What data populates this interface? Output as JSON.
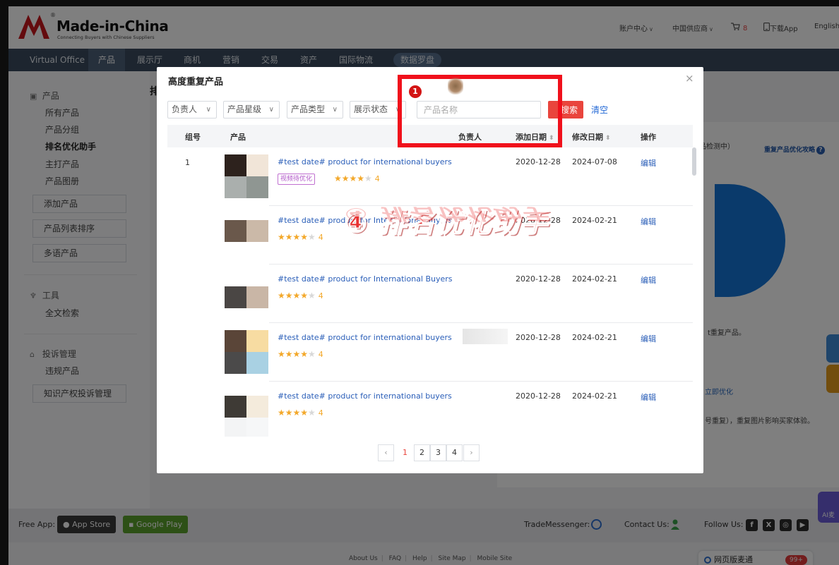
{
  "header": {
    "logo_name": "Made-in-China",
    "logo_slogan": "Connecting Buyers with Chinese Suppliers",
    "logo_reg": "®",
    "account_center": "账户中心",
    "china_supplier": "中国供应商",
    "cart_count": "8",
    "download_app": "下载App",
    "language": "English"
  },
  "nav": {
    "items": [
      "Virtual Office",
      "产品",
      "展示厅",
      "商机",
      "营销",
      "交易",
      "资产",
      "国际物流",
      "数据罗盘"
    ]
  },
  "sidebar": {
    "product_section": "产品",
    "product_items": [
      "所有产品",
      "产品分组",
      "排名优化助手",
      "主打产品",
      "产品图册"
    ],
    "box_buttons": [
      "添加产品",
      "产品列表排序",
      "多语产品"
    ],
    "tools_section": "工具",
    "tools_items": [
      "全文检索"
    ],
    "complaint_section": "投诉管理",
    "complaint_items": [
      "违规产品"
    ],
    "ip_button": "知识产权投诉管理"
  },
  "background": {
    "page_title": "排",
    "note": "品检测中）",
    "guide_link": "重复产品优化攻略",
    "text_repeat": "t重复产品。",
    "text_optimize": "立即优化",
    "text_hint": "号重复），重复图片影响买家体验。"
  },
  "footer": {
    "free_app": "Free App:",
    "app_store": "App Store",
    "google_play": "Google Play",
    "trade_messenger": "TradeMessenger:",
    "contact_us": "Contact Us:",
    "follow_us": "Follow Us:",
    "links": [
      "About Us",
      "FAQ",
      "Help",
      "Site Map",
      "Mobile Site"
    ],
    "webchat": "网页版麦通",
    "webchat_badge": "99+",
    "ai_label": "AI麦"
  },
  "modal": {
    "title": "高度重复产品",
    "close": "×",
    "filters": [
      "负责人",
      "产品星级",
      "产品类型",
      "展示状态"
    ],
    "search_placeholder": "产品名称",
    "search_button": "搜索",
    "clear": "清空",
    "columns": {
      "group": "组号",
      "product": "产品",
      "owner": "负责人",
      "add_date": "添加日期",
      "mod_date": "修改日期",
      "action": "操作"
    },
    "rows": [
      {
        "group": "1",
        "title": "#test date# product for international buyers",
        "tag": "视频待优化",
        "stars": 4,
        "score": "4",
        "add_date": "2020-12-28",
        "mod_date": "2024-07-08",
        "action": "编辑"
      },
      {
        "group": "",
        "title": "#test date# product for International Buyers",
        "tag": "",
        "stars": 4,
        "score": "4",
        "add_date": "2020-12-28",
        "mod_date": "2024-02-21",
        "action": "编辑"
      },
      {
        "group": "",
        "title": "#test date# product for International Buyers",
        "tag": "",
        "stars": 4,
        "score": "4",
        "add_date": "2020-12-28",
        "mod_date": "2024-02-21",
        "action": "编辑"
      },
      {
        "group": "",
        "title": "#test date# product for international buyers",
        "tag": "",
        "stars": 4,
        "score": "4",
        "add_date": "2020-12-28",
        "mod_date": "2024-02-21",
        "action": "编辑"
      },
      {
        "group": "",
        "title": "#test date# product for international buyers",
        "tag": "",
        "stars": 4,
        "score": "4",
        "add_date": "2020-12-28",
        "mod_date": "2024-02-21",
        "action": "编辑"
      }
    ],
    "pagination": {
      "prev": "‹",
      "pages": [
        "1",
        "2",
        "3",
        "4"
      ],
      "current": "1",
      "next": "›"
    }
  },
  "annotation": {
    "marker_number": "1",
    "watermark": "④ 排名优化助手"
  },
  "colors": {
    "nav_bg": "#3a4a5e",
    "accent_red": "#e9453d",
    "link_blue": "#2a5eb8",
    "star": "#f3a82a"
  }
}
